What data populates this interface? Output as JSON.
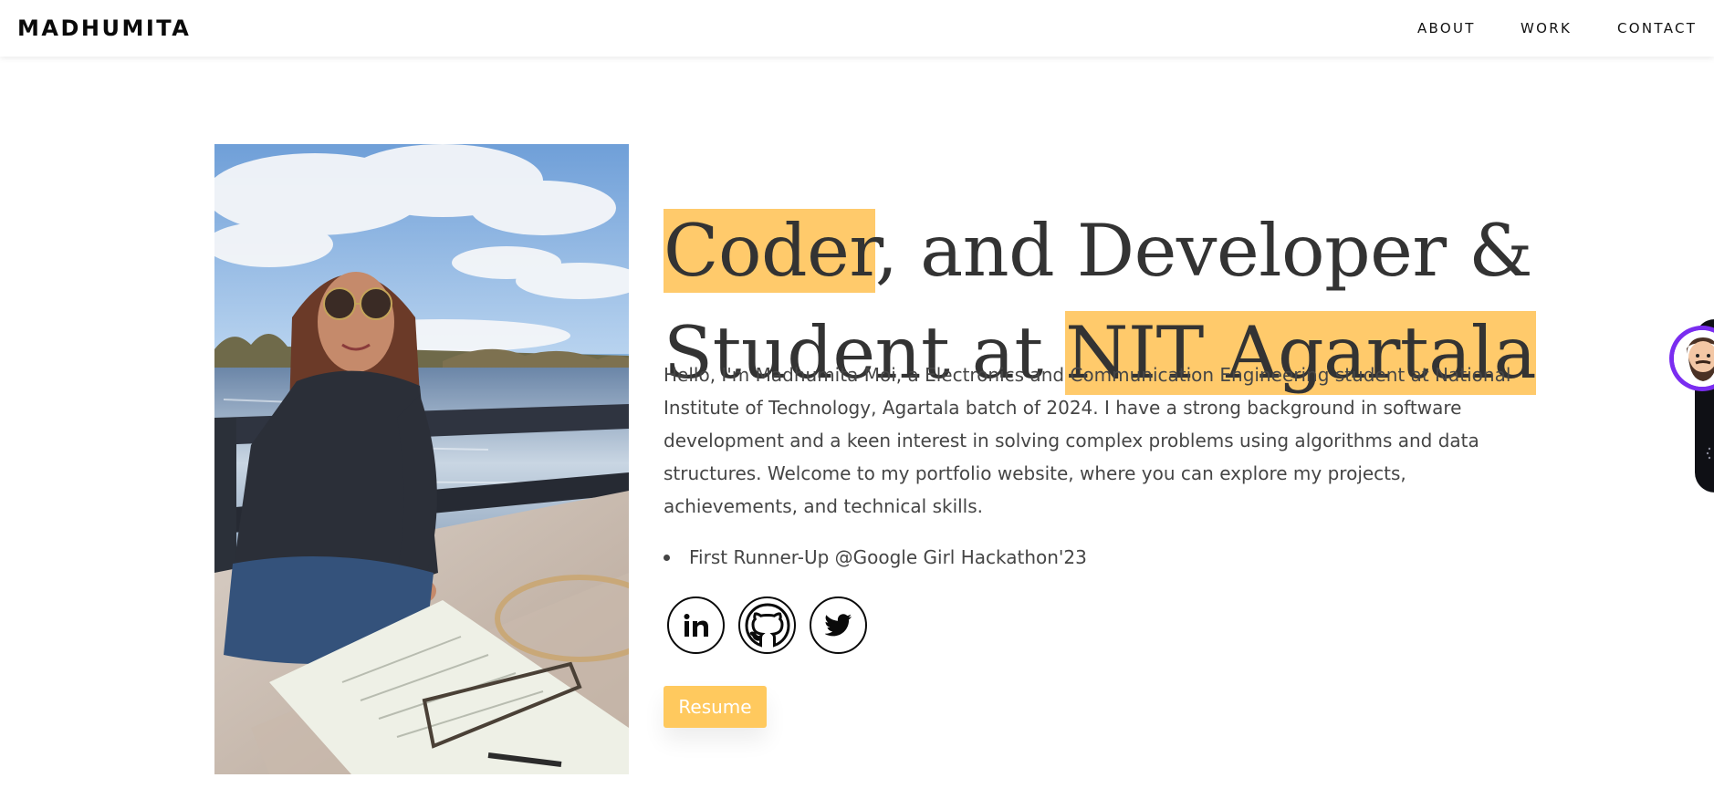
{
  "nav": {
    "brand": "MADHUMITA",
    "links": [
      {
        "label": "ABOUT"
      },
      {
        "label": "WORK"
      },
      {
        "label": "CONTACT"
      }
    ]
  },
  "hero": {
    "headline": {
      "part1_highlight": "Coder",
      "part1_rest": ", and Developer &",
      "part2_plain": "Student at ",
      "part2_highlight": "NIT Agartala"
    },
    "intro": "Hello, I'm Madhumita Moi, a Electronics and Communication Engineering student at National Institute of Technology, Agartala batch of 2024. I have a strong background in software development and a keen interest in solving complex problems using algorithms and data structures. Welcome to my portfolio website, where you can explore my projects, achievements, and technical skills.",
    "achievements": [
      "First Runner-Up @Google Girl Hackathon'23"
    ],
    "social": [
      {
        "name": "linkedin-icon",
        "label": "in"
      },
      {
        "name": "github-icon"
      },
      {
        "name": "twitter-icon"
      }
    ],
    "resume_label": "Resume"
  },
  "colors": {
    "highlight": "#ffca6b",
    "button": "#ffc95e",
    "chat_accent": "#7a2df0",
    "text": "#333333"
  }
}
